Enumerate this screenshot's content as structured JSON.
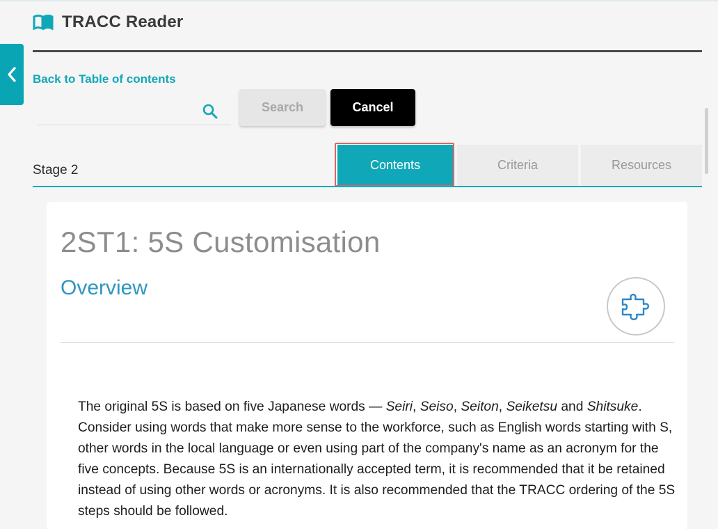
{
  "app": {
    "title": "TRACC Reader"
  },
  "navigation": {
    "back_link": "Back to Table of contents"
  },
  "search": {
    "value": "",
    "placeholder": "",
    "search_button": "Search",
    "cancel_button": "Cancel"
  },
  "stage": {
    "label": "Stage 2"
  },
  "tabs": [
    {
      "label": "Contents",
      "active": true
    },
    {
      "label": "Criteria",
      "active": false
    },
    {
      "label": "Resources",
      "active": false
    }
  ],
  "content": {
    "title": "2ST1: 5S Customisation",
    "section": "Overview",
    "badge_icon": "puzzle-icon",
    "paragraph": {
      "p1": "The original 5S is based on five Japanese words — ",
      "w1": "Seiri",
      "c1": ", ",
      "w2": "Seiso",
      "c2": ", ",
      "w3": "Seiton",
      "c3": ", ",
      "w4": "Seiketsu",
      "and": " and ",
      "w5": "Shitsuke",
      "rest": ". Consider using words that make more sense to the workforce, such as English words starting with S, other words in the local language or even using part of the company's name as an acronym for the five concepts. Because 5S is an internationally accepted term, it is recommended that it be retained instead of using other words or acronyms. It is also recommended that the TRACC ordering of the 5S steps should be followed."
    }
  },
  "colors": {
    "accent": "#10a8b8",
    "heading_blue": "#2e96c2",
    "title_gray": "#8d8d8d",
    "highlight": "#e06363"
  }
}
